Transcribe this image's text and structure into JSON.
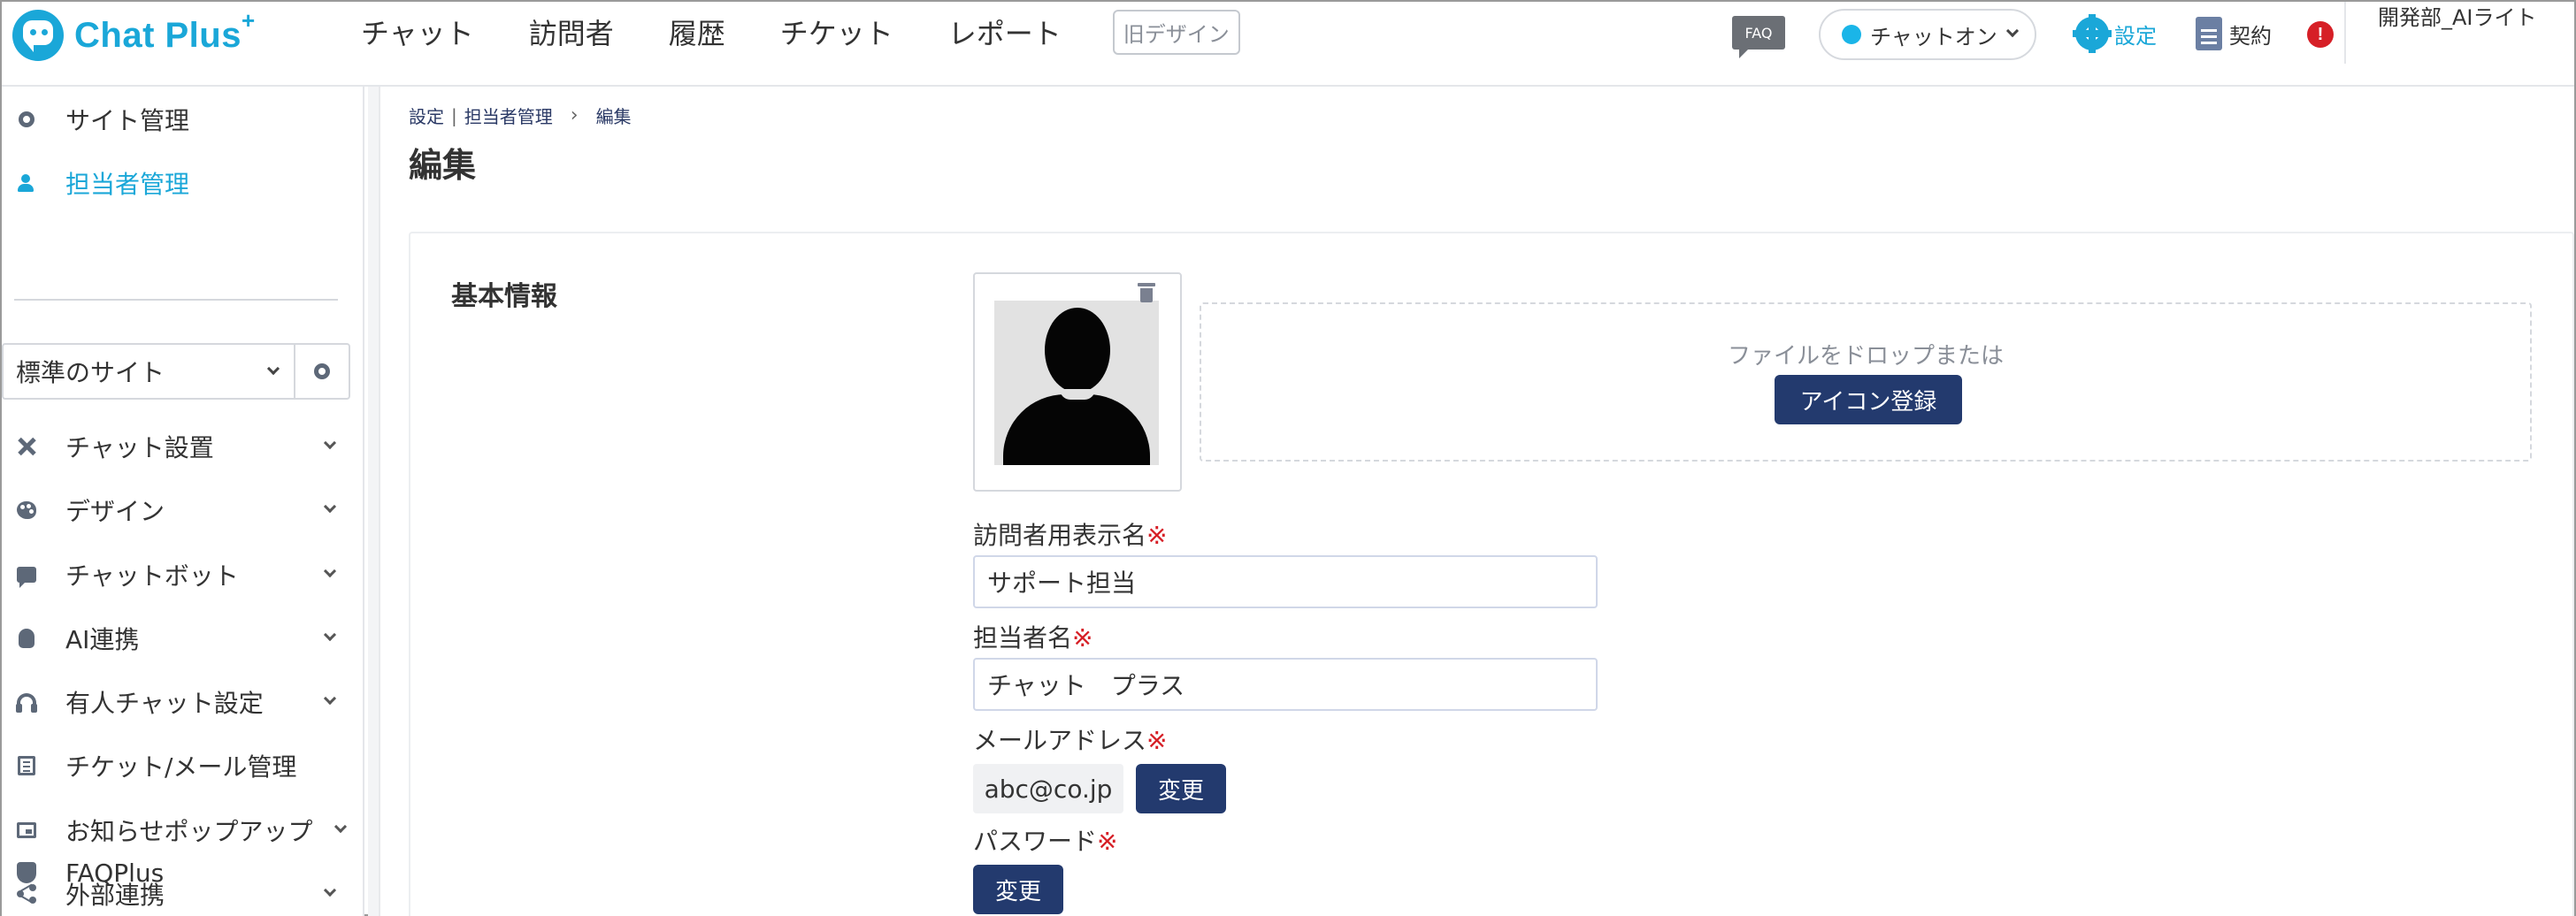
{
  "header": {
    "logo_text": "Chat Plus",
    "logo_sup": "+",
    "nav": [
      "チャット",
      "訪問者",
      "履歴",
      "チケット",
      "レポート"
    ],
    "old_design_label": "旧デザイン",
    "faq_label": "FAQ",
    "chat_status_label": "チャットオン",
    "settings_label": "設定",
    "contract_label": "契約",
    "alert_symbol": "!",
    "user_name": "開発部_AIライト"
  },
  "sidebar": {
    "top_items": [
      {
        "label": "サイト管理",
        "icon": "gear-icon"
      },
      {
        "label": "担当者管理",
        "icon": "user-icon"
      }
    ],
    "site_select_value": "標準のサイト",
    "menu_items": [
      {
        "label": "チャット設置",
        "icon": "tools-icon"
      },
      {
        "label": "デザイン",
        "icon": "palette-icon"
      },
      {
        "label": "チャットボット",
        "icon": "chat-bubble-icon"
      },
      {
        "label": "AI連携",
        "icon": "bulb-icon"
      },
      {
        "label": "有人チャット設定",
        "icon": "headset-icon"
      },
      {
        "label": "チケット/メール管理",
        "icon": "list-icon"
      },
      {
        "label": "お知らせポップアップ",
        "icon": "window-icon"
      },
      {
        "label": "外部連携",
        "icon": "share-icon"
      },
      {
        "label": "FAQPlus",
        "icon": "shield-icon"
      }
    ]
  },
  "breadcrumb": {
    "items": [
      "設定",
      "担当者管理",
      "編集"
    ],
    "separator_1": "|",
    "separator_2": "›"
  },
  "page_title": "編集",
  "form": {
    "section_title": "基本情報",
    "drop_text": "ファイルをドロップまたは",
    "icon_register_label": "アイコン登録",
    "display_name_label": "訪問者用表示名",
    "display_name_value": "サポート担当",
    "staff_name_label": "担当者名",
    "staff_name_value": "チャット　プラス",
    "email_label": "メールアドレス",
    "email_value": "abc@co.jp",
    "change_label": "変更",
    "password_label": "パスワード",
    "required_mark": "※"
  },
  "colors": {
    "accent": "#1aa7d8",
    "navy_button": "#233a6e",
    "required": "#d61f26"
  }
}
